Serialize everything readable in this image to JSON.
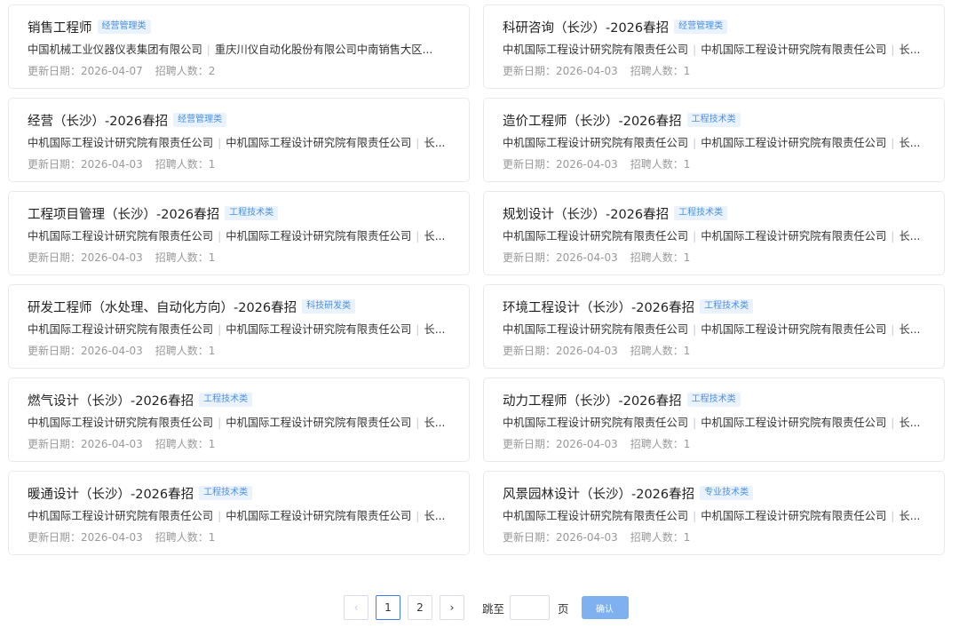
{
  "jobs": [
    {
      "title": "销售工程师",
      "tag": "经营管理类",
      "company_a": "中国机械工业仪器仪表集团有限公司",
      "company_b": "重庆川仪自动化股份有限公司中南销售大区...",
      "company_c": "",
      "date_label": "更新日期：",
      "date": "2026-04-07",
      "count_label": "招聘人数：",
      "count": "2"
    },
    {
      "title": "科研咨询（长沙）-2026春招",
      "tag": "经营管理类",
      "company_a": "中机国际工程设计研究院有限责任公司",
      "company_b": "中机国际工程设计研究院有限责任公司",
      "company_c": "长...",
      "date_label": "更新日期：",
      "date": "2026-04-03",
      "count_label": "招聘人数：",
      "count": "1"
    },
    {
      "title": "经营（长沙）-2026春招",
      "tag": "经营管理类",
      "company_a": "中机国际工程设计研究院有限责任公司",
      "company_b": "中机国际工程设计研究院有限责任公司",
      "company_c": "长...",
      "date_label": "更新日期：",
      "date": "2026-04-03",
      "count_label": "招聘人数：",
      "count": "1"
    },
    {
      "title": "造价工程师（长沙）-2026春招",
      "tag": "工程技术类",
      "company_a": "中机国际工程设计研究院有限责任公司",
      "company_b": "中机国际工程设计研究院有限责任公司",
      "company_c": "长...",
      "date_label": "更新日期：",
      "date": "2026-04-03",
      "count_label": "招聘人数：",
      "count": "1"
    },
    {
      "title": "工程项目管理（长沙）-2026春招",
      "tag": "工程技术类",
      "company_a": "中机国际工程设计研究院有限责任公司",
      "company_b": "中机国际工程设计研究院有限责任公司",
      "company_c": "长...",
      "date_label": "更新日期：",
      "date": "2026-04-03",
      "count_label": "招聘人数：",
      "count": "1"
    },
    {
      "title": "规划设计（长沙）-2026春招",
      "tag": "工程技术类",
      "company_a": "中机国际工程设计研究院有限责任公司",
      "company_b": "中机国际工程设计研究院有限责任公司",
      "company_c": "长...",
      "date_label": "更新日期：",
      "date": "2026-04-03",
      "count_label": "招聘人数：",
      "count": "1"
    },
    {
      "title": "研发工程师（水处理、自动化方向）-2026春招",
      "tag": "科技研发类",
      "company_a": "中机国际工程设计研究院有限责任公司",
      "company_b": "中机国际工程设计研究院有限责任公司",
      "company_c": "长...",
      "date_label": "更新日期：",
      "date": "2026-04-03",
      "count_label": "招聘人数：",
      "count": "1"
    },
    {
      "title": "环境工程设计（长沙）-2026春招",
      "tag": "工程技术类",
      "company_a": "中机国际工程设计研究院有限责任公司",
      "company_b": "中机国际工程设计研究院有限责任公司",
      "company_c": "长...",
      "date_label": "更新日期：",
      "date": "2026-04-03",
      "count_label": "招聘人数：",
      "count": "1"
    },
    {
      "title": "燃气设计（长沙）-2026春招",
      "tag": "工程技术类",
      "company_a": "中机国际工程设计研究院有限责任公司",
      "company_b": "中机国际工程设计研究院有限责任公司",
      "company_c": "长...",
      "date_label": "更新日期：",
      "date": "2026-04-03",
      "count_label": "招聘人数：",
      "count": "1"
    },
    {
      "title": "动力工程师（长沙）-2026春招",
      "tag": "工程技术类",
      "company_a": "中机国际工程设计研究院有限责任公司",
      "company_b": "中机国际工程设计研究院有限责任公司",
      "company_c": "长...",
      "date_label": "更新日期：",
      "date": "2026-04-03",
      "count_label": "招聘人数：",
      "count": "1"
    },
    {
      "title": "暖通设计（长沙）-2026春招",
      "tag": "工程技术类",
      "company_a": "中机国际工程设计研究院有限责任公司",
      "company_b": "中机国际工程设计研究院有限责任公司",
      "company_c": "长...",
      "date_label": "更新日期：",
      "date": "2026-04-03",
      "count_label": "招聘人数：",
      "count": "1"
    },
    {
      "title": "风景园林设计（长沙）-2026春招",
      "tag": "专业技术类",
      "company_a": "中机国际工程设计研究院有限责任公司",
      "company_b": "中机国际工程设计研究院有限责任公司",
      "company_c": "长...",
      "date_label": "更新日期：",
      "date": "2026-04-03",
      "count_label": "招聘人数：",
      "count": "1"
    }
  ],
  "pagination": {
    "prev_icon": "‹",
    "next_icon": "›",
    "pages": [
      "1",
      "2"
    ],
    "current_page": "1",
    "jump_label": "跳至",
    "jump_value": "",
    "page_unit": "页",
    "confirm_label": "确认"
  },
  "colors": {
    "tag_text": "#4a90e2",
    "tag_bg": "#eaf3fd",
    "confirm_bg": "#7fb0ef",
    "active_border": "#3c82e6"
  }
}
